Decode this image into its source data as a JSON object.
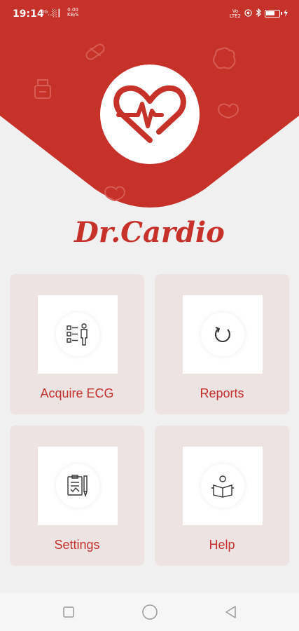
{
  "status_bar": {
    "time": "19:14",
    "signal": "²ᴳ‥░┃",
    "speed_value": "0.00",
    "speed_unit": "KB/S",
    "volte_line1": "Vo",
    "volte_line2": "LTE2"
  },
  "app_title": "Dr.Cardio",
  "menu": {
    "acquire_ecg": "Acquire ECG",
    "reports": "Reports",
    "settings": "Settings",
    "help": "Help"
  },
  "colors": {
    "brand_red": "#c6312a",
    "card_bg": "#ede3e3",
    "page_bg": "#f1f0f0"
  },
  "icons": {
    "header_decor": [
      "pill-icon",
      "medicine-bottle-icon",
      "brain-icon",
      "heart-outline-icon"
    ],
    "logo": "heart-pulse-icon",
    "acquire_ecg": "checklist-person-icon",
    "reports": "refresh-icon",
    "settings": "clipboard-pen-icon",
    "help": "reading-person-icon",
    "nav": [
      "recent-apps-icon",
      "home-icon",
      "back-icon"
    ]
  }
}
